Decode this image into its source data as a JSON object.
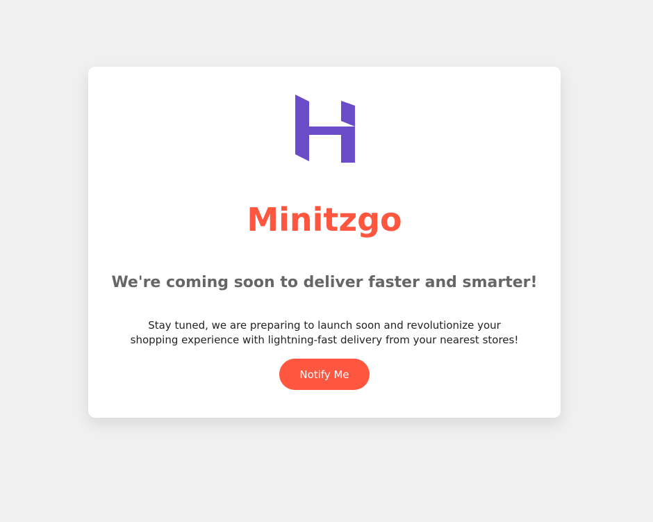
{
  "brand": {
    "name": "Minitzgo",
    "logo_icon": "hostinger-h-logo",
    "logo_color": "#6a4cc9",
    "name_color": "#ff5640"
  },
  "headline": "We're coming soon to deliver faster and smarter!",
  "description": "Stay tuned, we are preparing to launch soon and revolutionize your shopping experience with lightning-fast delivery from your nearest stores!",
  "cta": {
    "label": "Notify Me",
    "color": "#ff5640"
  }
}
